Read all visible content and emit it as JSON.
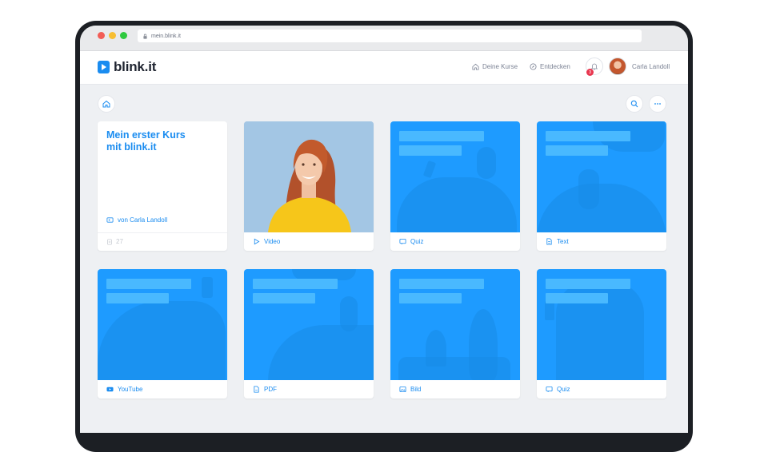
{
  "browser": {
    "url": "mein.blink.it"
  },
  "app": {
    "logo_text": "blink.it",
    "nav": [
      {
        "label": "Deine Kurse",
        "icon": "home-icon"
      },
      {
        "label": "Entdecken",
        "icon": "compass-icon"
      }
    ],
    "notifications": {
      "count": "3",
      "icon": "bell-icon"
    },
    "user": {
      "name": "Carla Landoll"
    }
  },
  "toolbar": {
    "home_icon": "home-icon",
    "search_icon": "search-icon",
    "more_icon": "more-icon"
  },
  "intro_card": {
    "title_line1": "Mein erster Kurs",
    "title_line2": "mit blink.it",
    "author": "von Carla Landoll",
    "count": "27"
  },
  "cards": [
    {
      "label": "Video",
      "icon": "play-icon"
    },
    {
      "label": "Quiz",
      "icon": "quiz-icon"
    },
    {
      "label": "Text",
      "icon": "document-icon"
    },
    {
      "label": "YouTube",
      "icon": "youtube-icon"
    },
    {
      "label": "PDF",
      "icon": "pdf-icon"
    },
    {
      "label": "Bild",
      "icon": "image-icon"
    },
    {
      "label": "Quiz",
      "icon": "quiz-icon"
    }
  ],
  "colors": {
    "accent": "#1a8cf0",
    "card_blue": "#1e9bff",
    "badge": "#e8364e"
  }
}
